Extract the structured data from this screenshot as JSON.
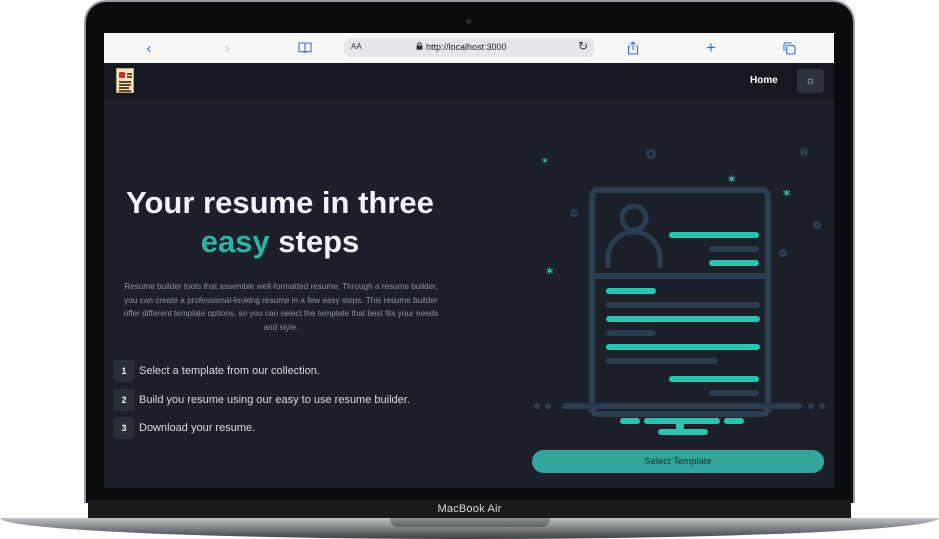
{
  "device": {
    "label": "MacBook Air"
  },
  "browser": {
    "text_size_label": "AA",
    "url": "http://localhost:3000",
    "buttons": {
      "back": "‹",
      "forward": "›",
      "bookmarks": "📖",
      "share": "⇪",
      "new_tab": "+",
      "tabs": "❐",
      "reload": "↻",
      "lock": "🔒"
    }
  },
  "app": {
    "nav": {
      "home_label": "Home",
      "theme_toggle_icon": "☼"
    },
    "hero": {
      "title_line1": "Your resume in three",
      "title_accent": "easy",
      "title_end": "steps",
      "description": "Resume builder tools that assemble well-formatted resume. Through a resume builder, you can create a professional-looking resume in a few easy steps. This resume builder offer different template options, so you can select the template that best fits your needs and style."
    },
    "steps": [
      {
        "number": "1",
        "text": "Select a template from our collection."
      },
      {
        "number": "2",
        "text": "Build you resume using our easy to use resume builder."
      },
      {
        "number": "3",
        "text": "Download your resume."
      }
    ],
    "cta": {
      "label": "Select Template"
    }
  },
  "colors": {
    "accent": "#2bb5a7",
    "background": "#1b202a",
    "button": "#34a59c"
  }
}
